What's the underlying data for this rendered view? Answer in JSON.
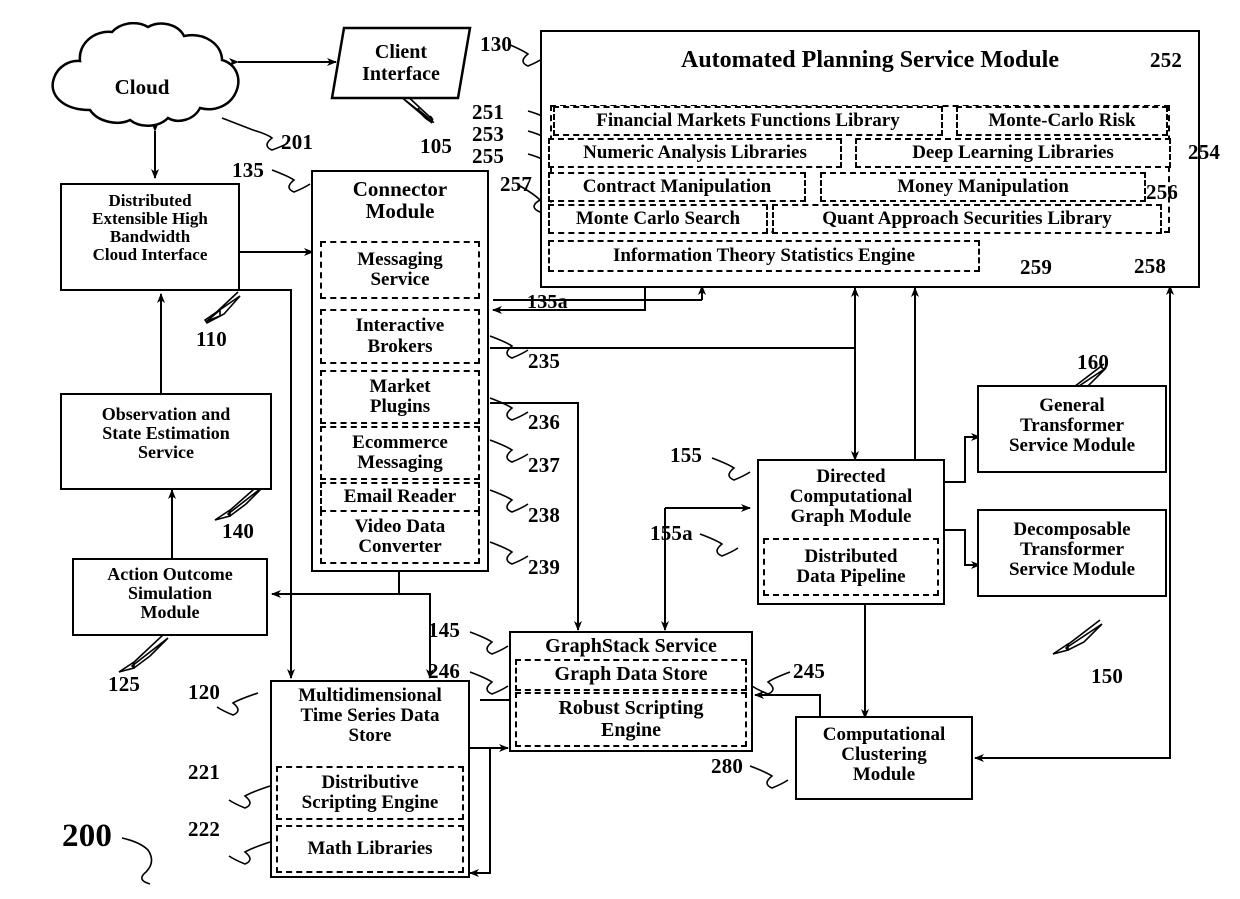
{
  "figure": {
    "number": "200",
    "type": "patent-block-diagram"
  },
  "nodes": {
    "cloud": {
      "label": "Cloud",
      "ref": "201"
    },
    "client_interface": {
      "label": "Client\nInterface",
      "ref": "105"
    },
    "distributed_cloud_interface": {
      "label": "Distributed\nExtensible High\nBandwidth\nCloud Interface",
      "ref": "110"
    },
    "observation_service": {
      "label": "Observation and\nState Estimation\nService",
      "ref": "140"
    },
    "action_outcome": {
      "label": "Action Outcome\nSimulation\nModule",
      "ref": "125"
    },
    "connector_module": {
      "label": "Connector\nModule",
      "ref": "135"
    },
    "automated_planning": {
      "label": "Automated Planning Service Module",
      "ref": "130"
    },
    "directed_graph": {
      "label": "Directed\nComputational\nGraph Module",
      "ref": "155"
    },
    "general_transformer": {
      "label": "General\nTransformer\nService Module",
      "ref": "160"
    },
    "decomposable_transformer": {
      "label": "Decomposable\nTransformer\nService Module",
      "ref": "150"
    },
    "graphstack": {
      "label": "GraphStack Service",
      "ref": "145"
    },
    "multidim_store": {
      "label": "Multidimensional\nTime Series Data\nStore",
      "ref": "120"
    },
    "computational_clustering": {
      "label": "Computational\nClustering\nModule",
      "ref": "280"
    }
  },
  "connector_submodules": [
    {
      "label": "Messaging\nService",
      "ref": "135a"
    },
    {
      "label": "Interactive\nBrokers",
      "ref": "235"
    },
    {
      "label": "Market\nPlugins",
      "ref": "236"
    },
    {
      "label": "Ecommerce\nMessaging",
      "ref": "237"
    },
    {
      "label": "Email Reader",
      "ref": "238"
    },
    {
      "label": "Video Data\nConverter",
      "ref": "239"
    }
  ],
  "planning_libraries": [
    {
      "label": "Financial Markets Functions Library",
      "ref": "251"
    },
    {
      "label": "Monte-Carlo Risk",
      "ref": "252"
    },
    {
      "label": "Numeric Analysis Libraries",
      "ref": "253"
    },
    {
      "label": "Deep Learning Libraries",
      "ref": "254"
    },
    {
      "label": "Contract Manipulation",
      "ref": "255"
    },
    {
      "label": "Money Manipulation",
      "ref": "256"
    },
    {
      "label": "Monte Carlo Search",
      "ref": "257"
    },
    {
      "label": "Quant Approach Securities Library",
      "ref": "258"
    },
    {
      "label": "Information Theory Statistics Engine",
      "ref": "259"
    }
  ],
  "other_submodules": [
    {
      "label": "Distributed\nData Pipeline",
      "ref": "155a"
    },
    {
      "label": "Graph Data Store",
      "ref": "245"
    },
    {
      "label": "Robust Scripting\nEngine",
      "ref": "246"
    },
    {
      "label": "Distributive\nScripting Engine",
      "ref": "221"
    },
    {
      "label": "Math Libraries",
      "ref": "222"
    }
  ],
  "reference_numbers": [
    "201",
    "105",
    "130",
    "135",
    "135a",
    "110",
    "140",
    "125",
    "120",
    "221",
    "222",
    "145",
    "245",
    "246",
    "155",
    "155a",
    "160",
    "150",
    "280",
    "251",
    "252",
    "253",
    "254",
    "255",
    "256",
    "257",
    "258",
    "259",
    "235",
    "236",
    "237",
    "238",
    "239",
    "200"
  ]
}
